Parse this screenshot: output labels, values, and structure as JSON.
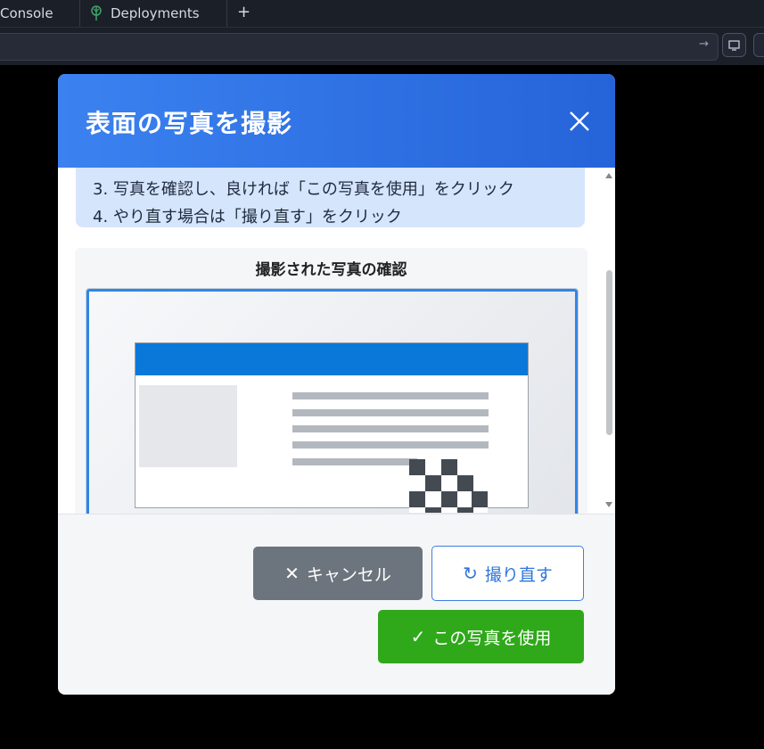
{
  "browser": {
    "tabs": [
      {
        "label": "Console"
      },
      {
        "label": "Deployments",
        "icon": "tree-icon"
      }
    ],
    "new_tab_label": "+",
    "url_go_icon": "→"
  },
  "modal": {
    "title": "表面の写真を撮影",
    "instructions": {
      "line3": "3. 写真を確認し、良ければ「この写真を使用」をクリック",
      "line4": "4. やり直す場合は「撮り直す」をクリック"
    },
    "preview_title": "撮影された写真の確認",
    "buttons": {
      "cancel": {
        "icon": "✕",
        "label": "キャンセル"
      },
      "retake": {
        "icon": "↻",
        "label": "撮り直す"
      },
      "use": {
        "icon": "✓",
        "label": "この写真を使用"
      }
    }
  },
  "colors": {
    "header_start": "#3b82f0",
    "header_end": "#2563d9",
    "cancel": "#6c757d",
    "retake_text": "#2f76d9",
    "use": "#2fa81a",
    "card_header": "#0a78d8"
  }
}
